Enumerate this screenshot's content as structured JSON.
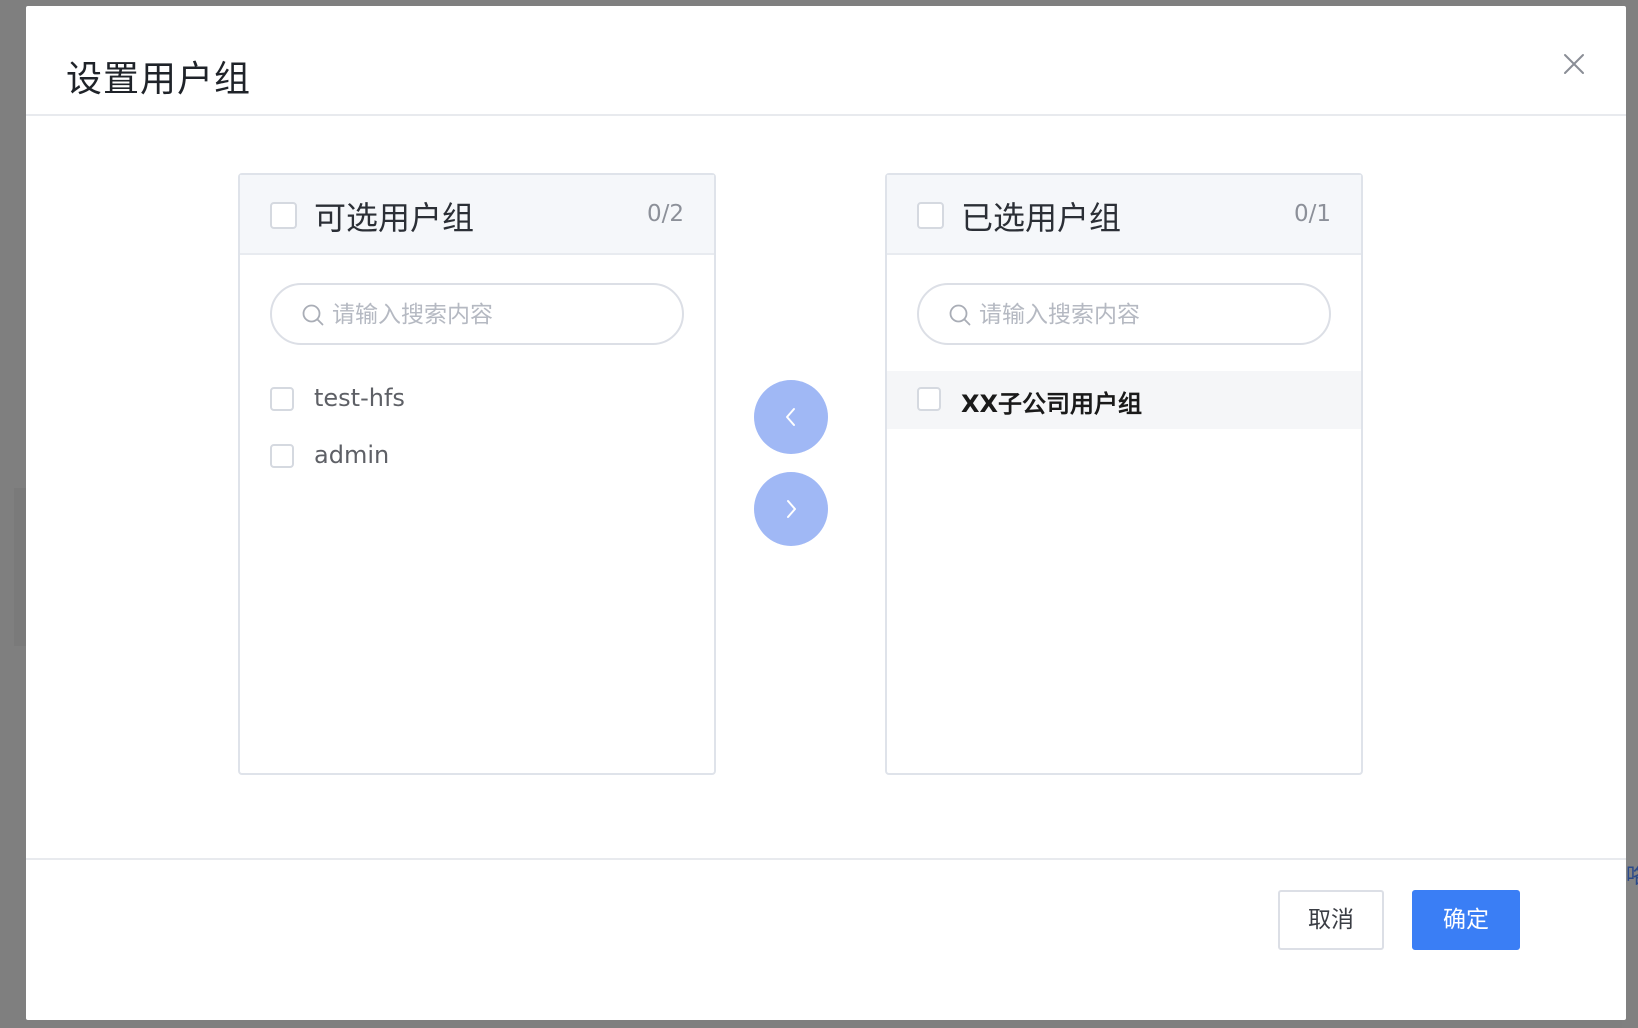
{
  "dialog": {
    "title": "设置用户组",
    "close_icon": "close-icon"
  },
  "source_panel": {
    "title": "可选用户组",
    "count": "0/2",
    "search_placeholder": "请输入搜索内容",
    "items": [
      {
        "label": "test-hfs",
        "checked": false
      },
      {
        "label": "admin",
        "checked": false
      }
    ]
  },
  "target_panel": {
    "title": "已选用户组",
    "count": "0/1",
    "search_placeholder": "请输入搜索内容",
    "items": [
      {
        "label": "XX子公司用户组",
        "checked": false,
        "hovered": true
      }
    ]
  },
  "transfer": {
    "to_left_icon": "chevron-left-icon",
    "to_right_icon": "chevron-right-icon",
    "button_color": "#a0b8f5"
  },
  "footer": {
    "cancel_label": "取消",
    "ok_label": "确定"
  },
  "background": {
    "edge_text": "咯"
  },
  "colors": {
    "primary": "#3a7ef5",
    "overlay": "#7f7f7f"
  }
}
